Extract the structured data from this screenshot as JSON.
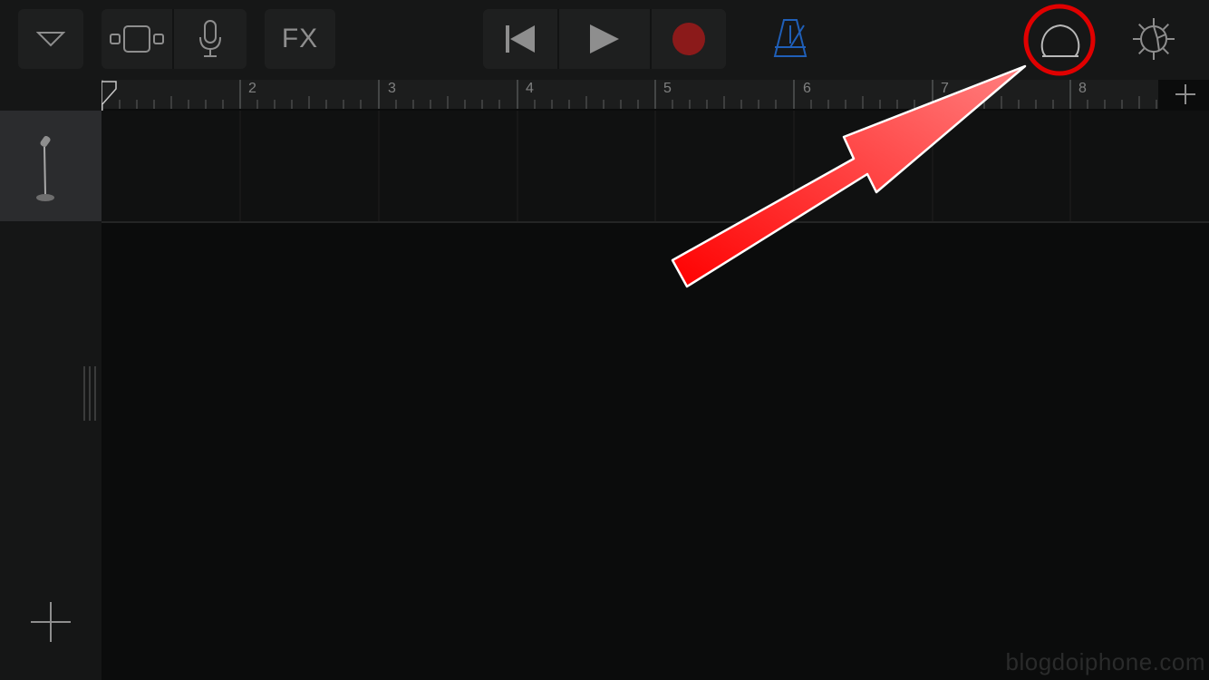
{
  "toolbar": {
    "fx_label": "FX",
    "icons": {
      "browser": "triangle-down-icon",
      "view": "track-view-icon",
      "input": "microphone-icon",
      "fx": "fx-icon",
      "rewind": "go-to-beginning-icon",
      "play": "play-icon",
      "record": "record-icon",
      "metronome": "metronome-icon",
      "loops": "loop-browser-icon",
      "settings": "gear-icon"
    },
    "colors": {
      "record": "#8b1a1a",
      "metronome": "#1f5fb8",
      "highlight": "#e00000"
    }
  },
  "ruler": {
    "bars": [
      "2",
      "3",
      "4",
      "5",
      "6",
      "7",
      "8"
    ],
    "add_section_icon": "plus-icon"
  },
  "tracks": [
    {
      "instrument_icon": "microphone-stand-icon"
    }
  ],
  "sidebar": {
    "add_track_icon": "plus-icon"
  },
  "watermark": "blogdoiphone.com"
}
